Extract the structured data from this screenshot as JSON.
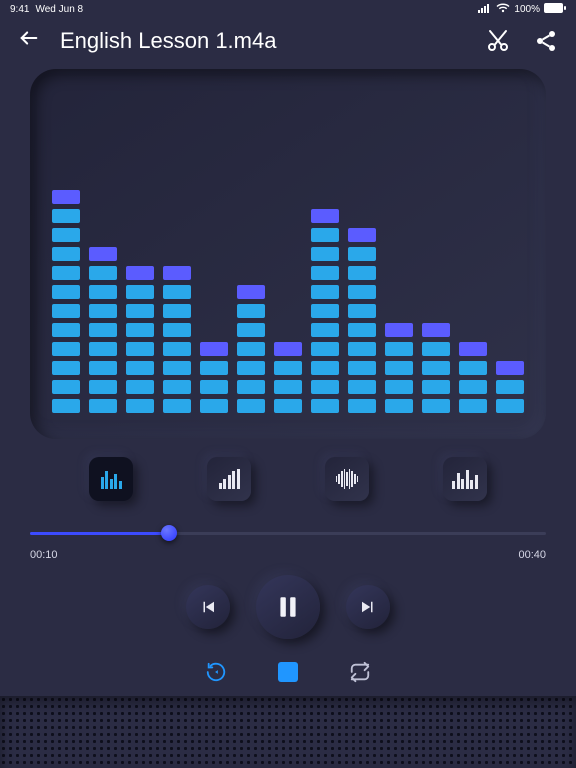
{
  "status": {
    "time": "9:41",
    "date": "Wed Jun 8",
    "battery": "100%"
  },
  "header": {
    "title": "English Lesson 1.m4a"
  },
  "visualizer": {
    "columns": [
      12,
      9,
      8,
      8,
      4,
      7,
      4,
      11,
      10,
      5,
      5,
      4,
      3
    ]
  },
  "playback": {
    "elapsed": "00:10",
    "total": "00:40",
    "progress": 0.27
  }
}
